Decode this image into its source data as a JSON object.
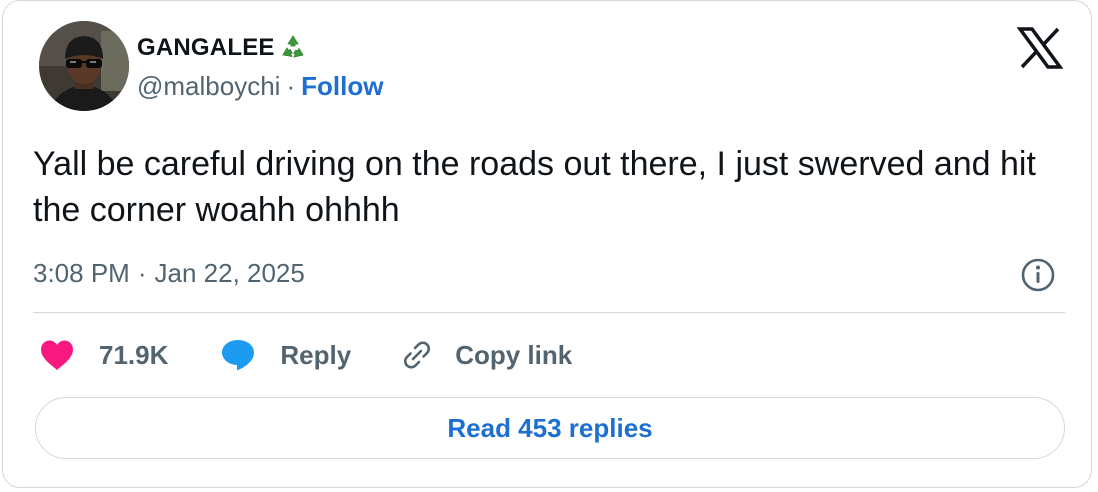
{
  "author": {
    "display_name": "GANGALEE",
    "handle": "@malboychi",
    "separator": "·",
    "follow_label": "Follow",
    "name_emoji_icon": "recycle-icon"
  },
  "tweet": {
    "text": "Yall be careful driving on the roads out there, I just swerved and hit the corner woahh ohhhh",
    "time": "3:08 PM",
    "separator": "·",
    "date": "Jan 22, 2025"
  },
  "actions": {
    "like_count": "71.9K",
    "reply_label": "Reply",
    "copy_link_label": "Copy link"
  },
  "read_replies_label": "Read 453 replies",
  "icons": {
    "brand": "x-logo-icon",
    "info": "info-icon",
    "like": "heart-icon",
    "reply": "speech-bubble-icon",
    "copy": "link-icon"
  },
  "colors": {
    "link_blue": "#1d6fd0",
    "heart_pink": "#f91880",
    "reply_blue": "#1d9bf0",
    "text_primary": "#0f1419",
    "text_secondary": "#536471",
    "border": "#cfd9de"
  }
}
